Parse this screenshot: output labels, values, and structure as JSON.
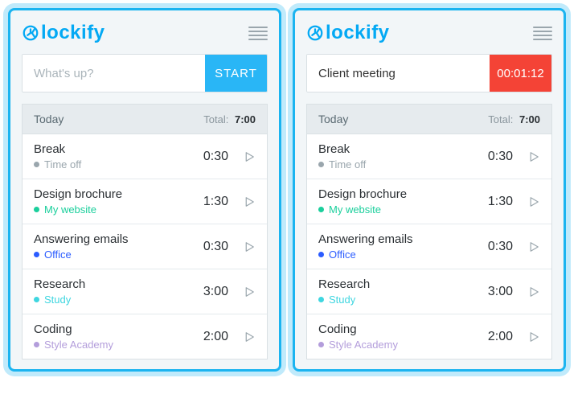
{
  "brand": "lockify",
  "left": {
    "placeholder": "What's up?",
    "value": "",
    "buttonLabel": "START"
  },
  "right": {
    "placeholder": "",
    "value": "Client meeting",
    "timer": "00:01:12"
  },
  "dayLabel": "Today",
  "totalLabel": "Total:",
  "totalValue": "7:00",
  "projectColors": {
    "timeoff": "#9aa6ad",
    "mywebsite": "#1bcf9c",
    "office": "#2b5cff",
    "study": "#3fd6e0",
    "styleacademy": "#b39ddb"
  },
  "entries": [
    {
      "title": "Break",
      "project": "Time off",
      "colorKey": "timeoff",
      "time": "0:30"
    },
    {
      "title": "Design brochure",
      "project": "My website",
      "colorKey": "mywebsite",
      "time": "1:30"
    },
    {
      "title": "Answering emails",
      "project": "Office",
      "colorKey": "office",
      "time": "0:30"
    },
    {
      "title": "Research",
      "project": "Study",
      "colorKey": "study",
      "time": "3:00"
    },
    {
      "title": "Coding",
      "project": "Style Academy",
      "colorKey": "styleacademy",
      "time": "2:00"
    }
  ]
}
